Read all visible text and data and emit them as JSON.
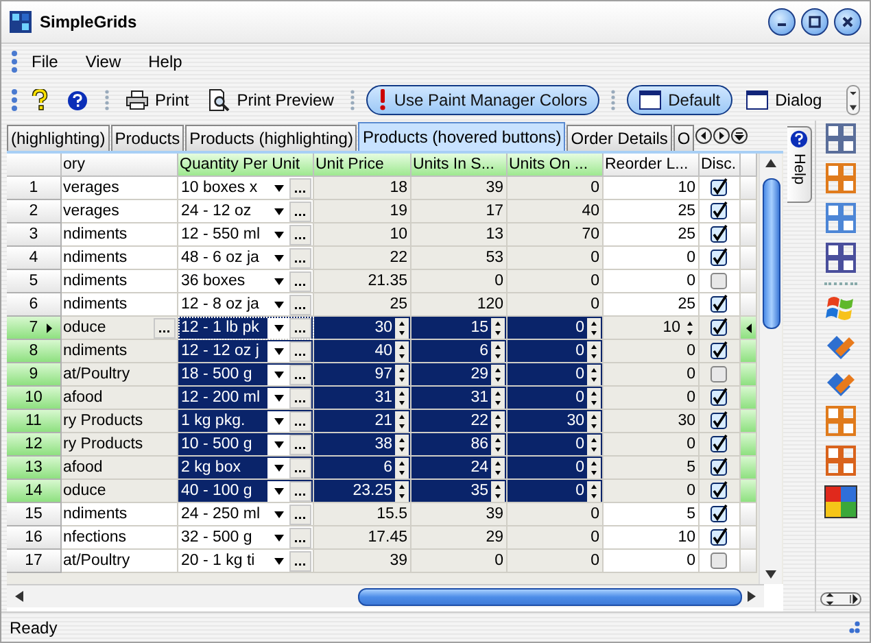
{
  "window": {
    "title": "SimpleGrids"
  },
  "menu": [
    {
      "label": "File"
    },
    {
      "label": "View"
    },
    {
      "label": "Help"
    }
  ],
  "toolbar": [
    {
      "kind": "whats-this"
    },
    {
      "kind": "about"
    },
    {
      "kind": "separator"
    },
    {
      "kind": "print",
      "label": "Print"
    },
    {
      "kind": "preview",
      "label": "Print Preview"
    },
    {
      "kind": "separator"
    },
    {
      "kind": "alert-toggle",
      "label": "Use Paint Manager Colors",
      "checked": true
    },
    {
      "kind": "separator"
    },
    {
      "kind": "window-toggle",
      "label": "Default",
      "checked": true
    },
    {
      "kind": "window-toggle",
      "label": "Dialog",
      "checked": false
    }
  ],
  "tabs": [
    {
      "label": "(highlighting)",
      "selected": false
    },
    {
      "label": "Products",
      "selected": false
    },
    {
      "label": "Products (highlighting)",
      "selected": false
    },
    {
      "label": "Products (hovered buttons)",
      "selected": true
    },
    {
      "label": "Order Details",
      "selected": false
    },
    {
      "label": "O",
      "selected": false
    }
  ],
  "side_tab": {
    "label": "Help"
  },
  "table": {
    "columns": [
      {
        "label": "ory",
        "highlighted": false
      },
      {
        "label": "Quantity Per Unit",
        "highlighted": true
      },
      {
        "label": "Unit Price",
        "highlighted": true
      },
      {
        "label": "Units In S...",
        "highlighted": true
      },
      {
        "label": "Units On ...",
        "highlighted": true
      },
      {
        "label": "Reorder L...",
        "highlighted": false
      },
      {
        "label": "Disc.",
        "highlighted": false
      }
    ],
    "rows": [
      {
        "number": "1",
        "category": "verages",
        "quantity": "10 boxes x",
        "unit_price": "18",
        "units_in_stock": "39",
        "units_on_order": "0",
        "reorder_level": "10",
        "discontinued": true,
        "selected": false,
        "current": false
      },
      {
        "number": "2",
        "category": "verages",
        "quantity": "24 - 12 oz",
        "unit_price": "19",
        "units_in_stock": "17",
        "units_on_order": "40",
        "reorder_level": "25",
        "discontinued": true,
        "selected": false,
        "current": false
      },
      {
        "number": "3",
        "category": "ndiments",
        "quantity": "12 - 550 ml",
        "unit_price": "10",
        "units_in_stock": "13",
        "units_on_order": "70",
        "reorder_level": "25",
        "discontinued": true,
        "selected": false,
        "current": false
      },
      {
        "number": "4",
        "category": "ndiments",
        "quantity": "48 - 6 oz ja",
        "unit_price": "22",
        "units_in_stock": "53",
        "units_on_order": "0",
        "reorder_level": "0",
        "discontinued": true,
        "selected": false,
        "current": false
      },
      {
        "number": "5",
        "category": "ndiments",
        "quantity": "36 boxes",
        "unit_price": "21.35",
        "units_in_stock": "0",
        "units_on_order": "0",
        "reorder_level": "0",
        "discontinued": false,
        "selected": false,
        "current": false
      },
      {
        "number": "6",
        "category": "ndiments",
        "quantity": "12 - 8 oz ja",
        "unit_price": "25",
        "units_in_stock": "120",
        "units_on_order": "0",
        "reorder_level": "25",
        "discontinued": true,
        "selected": false,
        "current": false
      },
      {
        "number": "7",
        "category": "oduce",
        "quantity": "12 - 1 lb pk",
        "unit_price": "30",
        "units_in_stock": "15",
        "units_on_order": "0",
        "reorder_level": "10",
        "discontinued": true,
        "selected": true,
        "current": true
      },
      {
        "number": "8",
        "category": "ndiments",
        "quantity": "12 - 12 oz j",
        "unit_price": "40",
        "units_in_stock": "6",
        "units_on_order": "0",
        "reorder_level": "0",
        "discontinued": true,
        "selected": true,
        "current": false
      },
      {
        "number": "9",
        "category": "at/Poultry",
        "quantity": "18 - 500 g",
        "unit_price": "97",
        "units_in_stock": "29",
        "units_on_order": "0",
        "reorder_level": "0",
        "discontinued": false,
        "selected": true,
        "current": false
      },
      {
        "number": "10",
        "category": "afood",
        "quantity": "12 - 200 ml",
        "unit_price": "31",
        "units_in_stock": "31",
        "units_on_order": "0",
        "reorder_level": "0",
        "discontinued": true,
        "selected": true,
        "current": false
      },
      {
        "number": "11",
        "category": "ry Products",
        "quantity": "1 kg pkg.",
        "unit_price": "21",
        "units_in_stock": "22",
        "units_on_order": "30",
        "reorder_level": "30",
        "discontinued": true,
        "selected": true,
        "current": false
      },
      {
        "number": "12",
        "category": "ry Products",
        "quantity": "10 - 500 g",
        "unit_price": "38",
        "units_in_stock": "86",
        "units_on_order": "0",
        "reorder_level": "0",
        "discontinued": true,
        "selected": true,
        "current": false
      },
      {
        "number": "13",
        "category": "afood",
        "quantity": "2 kg box",
        "unit_price": "6",
        "units_in_stock": "24",
        "units_on_order": "0",
        "reorder_level": "5",
        "discontinued": true,
        "selected": true,
        "current": false
      },
      {
        "number": "14",
        "category": "oduce",
        "quantity": "40 - 100 g",
        "unit_price": "23.25",
        "units_in_stock": "35",
        "units_on_order": "0",
        "reorder_level": "0",
        "discontinued": true,
        "selected": true,
        "current": false
      },
      {
        "number": "15",
        "category": "ndiments",
        "quantity": "24 - 250 ml",
        "unit_price": "15.5",
        "units_in_stock": "39",
        "units_on_order": "0",
        "reorder_level": "5",
        "discontinued": true,
        "selected": false,
        "current": false
      },
      {
        "number": "16",
        "category": "nfections",
        "quantity": "32 - 500 g",
        "unit_price": "17.45",
        "units_in_stock": "29",
        "units_on_order": "0",
        "reorder_level": "10",
        "discontinued": true,
        "selected": false,
        "current": false
      },
      {
        "number": "17",
        "category": "at/Poultry",
        "quantity": "20 - 1 kg ti",
        "unit_price": "39",
        "units_in_stock": "0",
        "units_on_order": "0",
        "reorder_level": "0",
        "discontinued": false,
        "selected": false,
        "current": false
      }
    ]
  },
  "status_bar": {
    "text": "Ready"
  }
}
